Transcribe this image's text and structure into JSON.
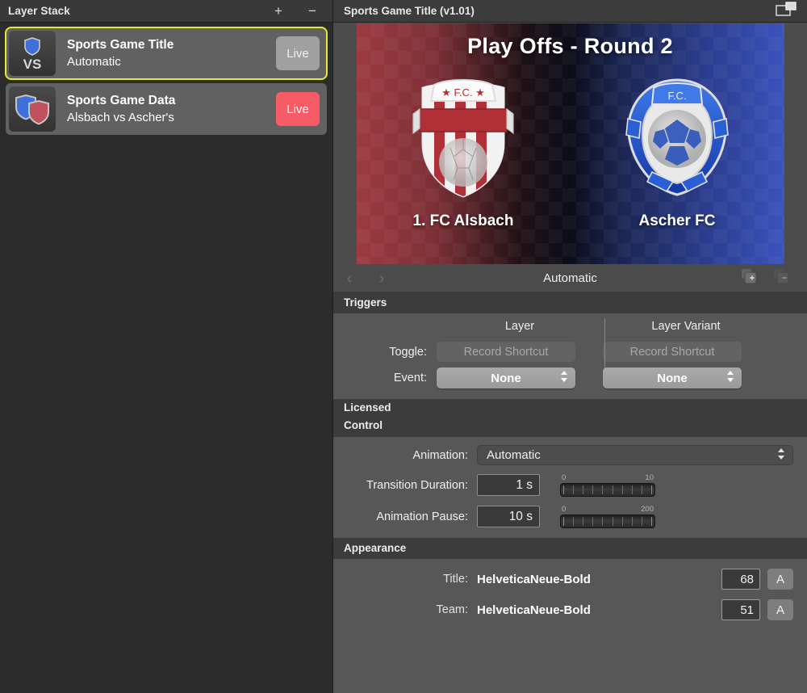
{
  "sidebar": {
    "title": "Layer Stack",
    "add_label": "+",
    "remove_label": "−",
    "add_icon": "plus-icon",
    "remove_icon": "minus-icon",
    "layers": [
      {
        "name": "Sports Game Title",
        "subtitle": "Automatic",
        "live_label": "Live",
        "live_state": "off",
        "icon": "vs-shield-icon",
        "selected": true
      },
      {
        "name": "Sports Game Data",
        "subtitle": "Alsbach vs Ascher's",
        "live_label": "Live",
        "live_state": "on",
        "icon": "two-shields-icon",
        "selected": false
      }
    ],
    "selection_color": "#e9e92e",
    "live_on_color": "#f75b66",
    "live_off_color": "#a0a0a0"
  },
  "panel": {
    "title": "Sports Game Title (v1.01)",
    "pip_icon": "detach-window-icon"
  },
  "preview": {
    "title": "Play Offs - Round 2",
    "teams": [
      {
        "name": "1. FC Alsbach",
        "crest": "red-white-striped-shield-crest",
        "color": "#b03038"
      },
      {
        "name": "Ascher FC",
        "crest": "blue-ball-shield-crest",
        "color": "#1f4fc4"
      }
    ]
  },
  "variant_bar": {
    "prev_icon": "chevron-left-icon",
    "next_icon": "chevron-right-icon",
    "name": "Automatic",
    "duplicate_add_icon": "duplicate-add-icon",
    "duplicate_remove_icon": "duplicate-remove-icon"
  },
  "triggers": {
    "section_title": "Triggers",
    "col_layer": "Layer",
    "col_layer_variant": "Layer Variant",
    "toggle_label": "Toggle:",
    "event_label": "Event:",
    "layer_shortcut_placeholder": "Record Shortcut",
    "variant_shortcut_placeholder": "Record Shortcut",
    "layer_event_value": "None",
    "variant_event_value": "None"
  },
  "licensed": {
    "section_title": "Licensed"
  },
  "control": {
    "section_title": "Control",
    "animation_label": "Animation:",
    "animation_value": "Automatic",
    "transition_label": "Transition Duration:",
    "transition_value": "1 s",
    "transition_min": "0",
    "transition_max": "10",
    "pause_label": "Animation Pause:",
    "pause_value": "10 s",
    "pause_min": "0",
    "pause_max": "200"
  },
  "appearance": {
    "section_title": "Appearance",
    "rows": [
      {
        "label": "Title:",
        "font": "HelveticaNeue-Bold",
        "size": "68",
        "button": "A"
      },
      {
        "label": "Team:",
        "font": "HelveticaNeue-Bold",
        "size": "51",
        "button": "A"
      }
    ]
  }
}
